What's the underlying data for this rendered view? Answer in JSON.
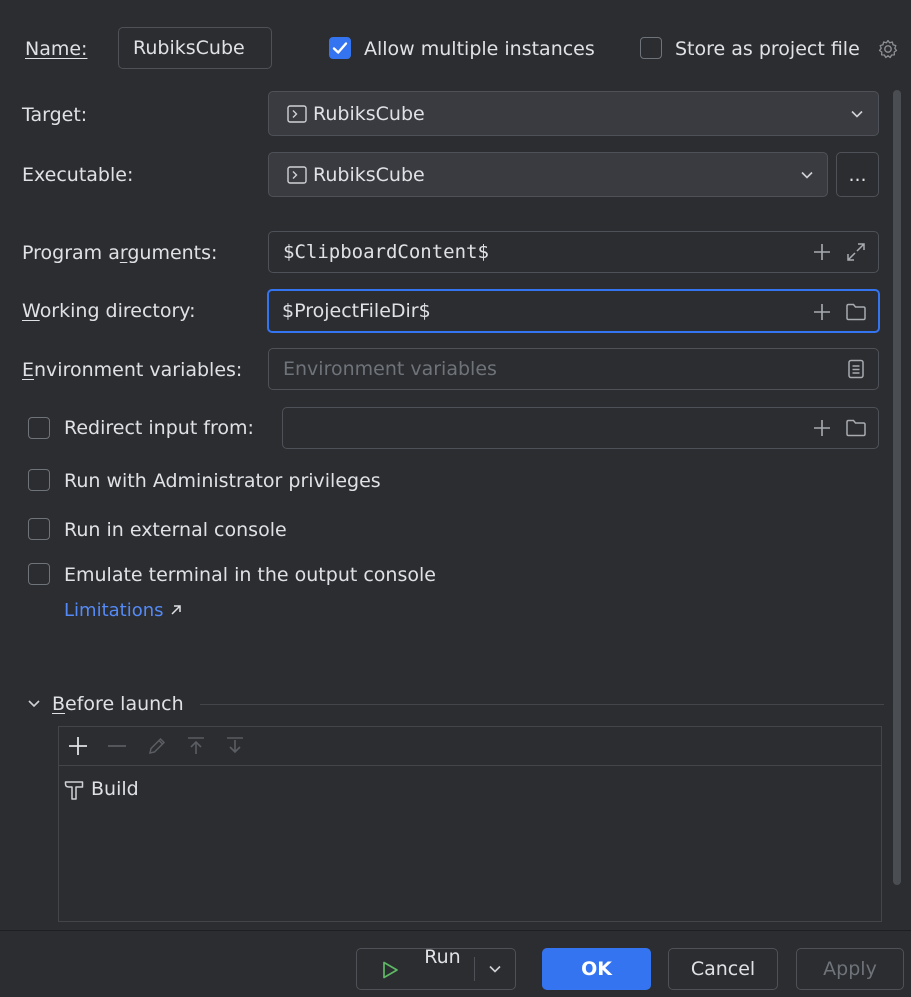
{
  "name": {
    "label": "Name:",
    "value": "RubiksCube"
  },
  "allow_multiple": {
    "label": "Allow multiple instances",
    "checked": true
  },
  "store_as_project": {
    "label": "Store as project file",
    "checked": false
  },
  "target": {
    "label": "Target:",
    "value": "RubiksCube"
  },
  "executable": {
    "label": "Executable:",
    "value": "RubiksCube",
    "browse_label": "..."
  },
  "program_arguments": {
    "label": "Program arguments:",
    "value": "$ClipboardContent$"
  },
  "working_directory": {
    "label": "Working directory:",
    "value": "$ProjectFileDir$"
  },
  "environment_variables": {
    "label": "Environment variables:",
    "placeholder": "Environment variables",
    "value": ""
  },
  "redirect_input": {
    "label": "Redirect input from:",
    "checked": false,
    "value": ""
  },
  "run_admin": {
    "label": "Run with Administrator privileges",
    "checked": false
  },
  "run_external": {
    "label": "Run in external console",
    "checked": false
  },
  "emulate_terminal": {
    "label": "Emulate terminal in the output console",
    "checked": false
  },
  "limitations_link": "Limitations",
  "before_launch": {
    "title": "Before launch",
    "items": [
      {
        "label": "Build",
        "icon": "hammer-icon"
      }
    ]
  },
  "buttons": {
    "run": "Run",
    "ok": "OK",
    "cancel": "Cancel",
    "apply": "Apply"
  },
  "colors": {
    "background": "#2b2d30",
    "accent": "#3574f0",
    "link": "#548af7",
    "run_icon": "#5fb865"
  }
}
